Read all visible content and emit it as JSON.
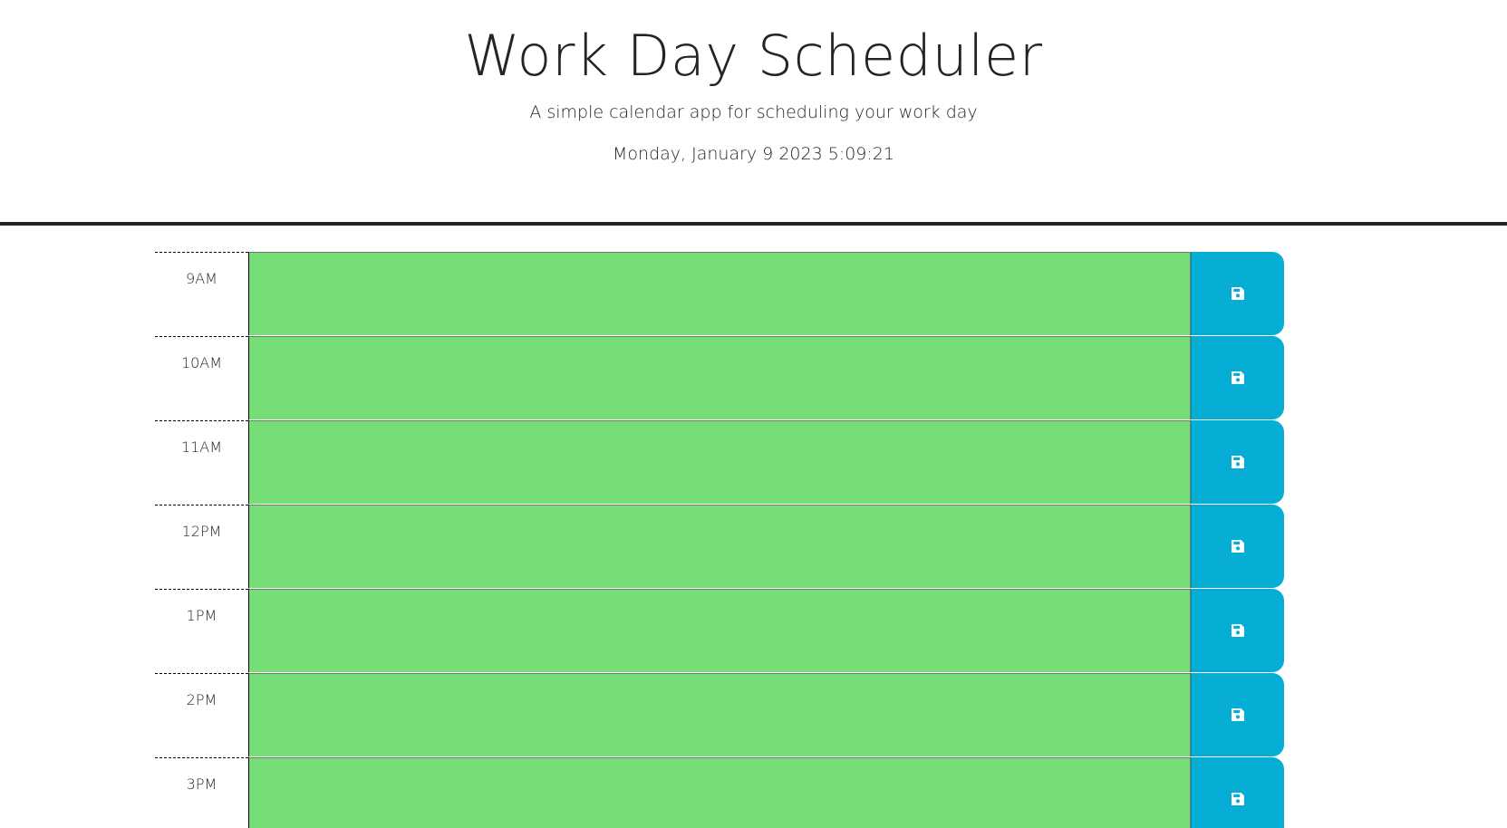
{
  "header": {
    "title": "Work Day Scheduler",
    "subtitle": "A simple calendar app for scheduling your work day",
    "current_datetime": "Monday, January 9 2023 5:09:21"
  },
  "time_blocks": [
    {
      "hour": "9AM",
      "text": "",
      "state": "future"
    },
    {
      "hour": "10AM",
      "text": "",
      "state": "future"
    },
    {
      "hour": "11AM",
      "text": "",
      "state": "future"
    },
    {
      "hour": "12PM",
      "text": "",
      "state": "future"
    },
    {
      "hour": "1PM",
      "text": "",
      "state": "future"
    },
    {
      "hour": "2PM",
      "text": "",
      "state": "future"
    },
    {
      "hour": "3PM",
      "text": "",
      "state": "future"
    }
  ],
  "save_icon": "floppy-disk-icon",
  "colors": {
    "future": "#77dd77",
    "save_button": "#06aed5",
    "divider": "#1f2429"
  }
}
